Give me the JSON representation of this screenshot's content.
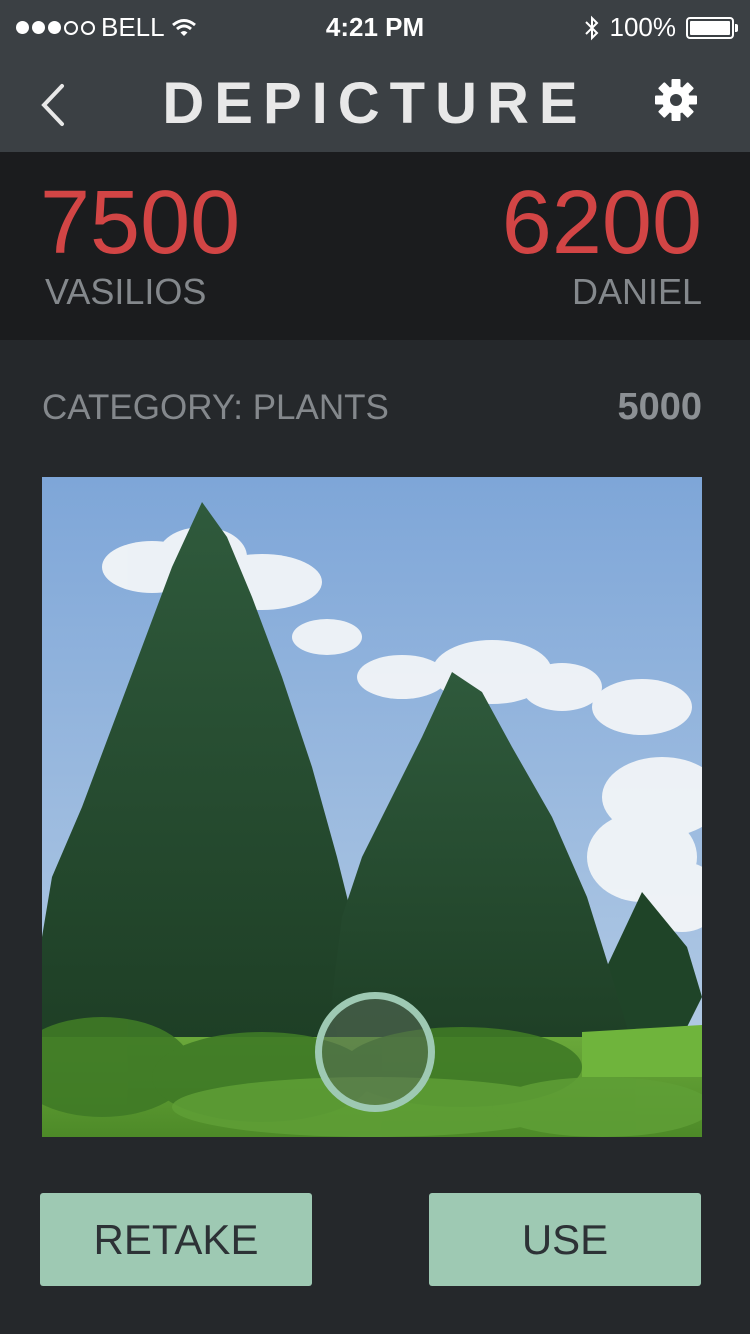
{
  "status": {
    "carrier": "BELL",
    "time": "4:21 PM",
    "battery": "100%",
    "signal_dots_filled": 3,
    "signal_dots_total": 5
  },
  "nav": {
    "title": "DEPICTURE",
    "back_icon": "chevron-left-icon",
    "settings_icon": "gear-icon"
  },
  "scores": {
    "player1": {
      "score": "7500",
      "name": "VASILIOS"
    },
    "player2": {
      "score": "6200",
      "name": "DANIEL"
    }
  },
  "round": {
    "category": "CATEGORY: PLANTS",
    "points": "5000"
  },
  "actions": {
    "retake_label": "RETAKE",
    "use_label": "USE"
  },
  "colors": {
    "accent_red": "#d24545",
    "button_green": "#9ec9b3",
    "background": "#25282b",
    "nav_bg": "#3b4044"
  }
}
